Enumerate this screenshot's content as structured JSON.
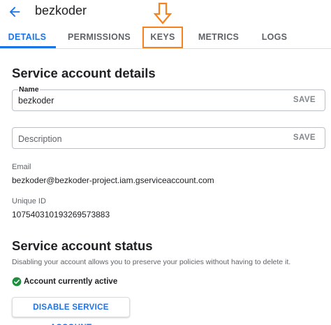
{
  "header": {
    "title": "bezkoder",
    "back_icon": "arrow-back-icon"
  },
  "tabs": [
    {
      "label": "DETAILS",
      "active": true
    },
    {
      "label": "PERMISSIONS",
      "active": false
    },
    {
      "label": "KEYS",
      "active": false
    },
    {
      "label": "METRICS",
      "active": false
    },
    {
      "label": "LOGS",
      "active": false
    }
  ],
  "annotation": {
    "arrow_icon": "arrow-down-outline-icon",
    "color": "#f5821f"
  },
  "details": {
    "heading": "Service account details",
    "name_label": "Name",
    "name_value": "bezkoder",
    "description_placeholder": "Description",
    "save_label": "SAVE",
    "email_label": "Email",
    "email_value": "bezkoder@bezkoder-project.iam.gserviceaccount.com",
    "unique_id_label": "Unique ID",
    "unique_id_value": "107540310193269573883"
  },
  "status": {
    "heading": "Service account status",
    "description": "Disabling your account allows you to preserve your policies without having to delete it.",
    "active_text": "Account currently active",
    "disable_button": "DISABLE SERVICE ACCOUNT",
    "check_icon": "check-circle-icon"
  },
  "colors": {
    "accent": "#1a73e8",
    "success": "#1e8e3e",
    "highlight": "#f5821f"
  }
}
